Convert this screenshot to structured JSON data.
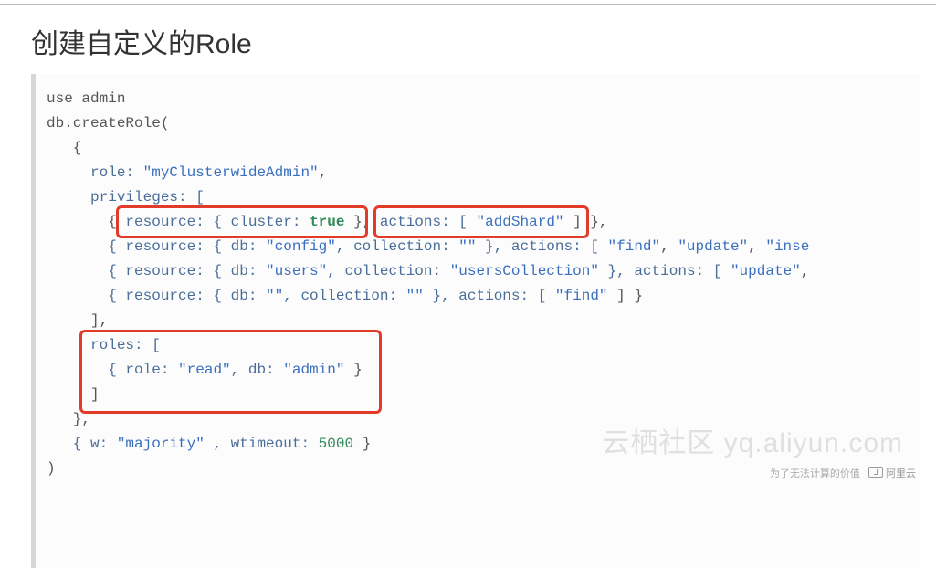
{
  "title": "创建自定义的Role",
  "code": {
    "l1": "use admin",
    "l2_a": "db.createRole(",
    "l3": "   {",
    "l4_a": "     role: ",
    "l4_b": "\"myClusterwideAdmin\"",
    "l4_c": ",",
    "l5": "     privileges: [",
    "l6_a": "       { ",
    "l6_b": "resource: { cluster: ",
    "l6_c": "true",
    "l6_d": " }",
    "l6_e": ", ",
    "l6_f": "actions: [ ",
    "l6_g": "\"addShard\"",
    "l6_h": " ]",
    "l6_i": " },",
    "l7_a": "       { resource: { db: ",
    "l7_b": "\"config\"",
    "l7_c": ", collection: ",
    "l7_d": "\"\"",
    "l7_e": " }, actions: [ ",
    "l7_f": "\"find\"",
    "l7_g": ", ",
    "l7_h": "\"update\"",
    "l7_i": ", ",
    "l7_j": "\"inse",
    "l8_a": "       { resource: { db: ",
    "l8_b": "\"users\"",
    "l8_c": ", collection: ",
    "l8_d": "\"usersCollection\"",
    "l8_e": " }, actions: [ ",
    "l8_f": "\"update\"",
    "l8_g": ",",
    "l9_a": "       { resource: { db: ",
    "l9_b": "\"\"",
    "l9_c": ", collection: ",
    "l9_d": "\"\"",
    "l9_e": " }, actions: [ ",
    "l9_f": "\"find\"",
    "l9_g": " ] }",
    "l10": "     ],",
    "l11": "     roles: [",
    "l12_a": "       { role: ",
    "l12_b": "\"read\"",
    "l12_c": ", db: ",
    "l12_d": "\"admin\"",
    "l12_e": " }",
    "l13": "     ]",
    "l14": "   },",
    "l15_a": "   { w: ",
    "l15_b": "\"majority\"",
    "l15_c": " , wtimeout: ",
    "l15_d": "5000",
    "l15_e": " }",
    "l16": ")"
  },
  "footer": {
    "tagline": "为了无法计算的价值",
    "brand": "阿里云"
  },
  "watermark": "云栖社区 yq.aliyun.com"
}
